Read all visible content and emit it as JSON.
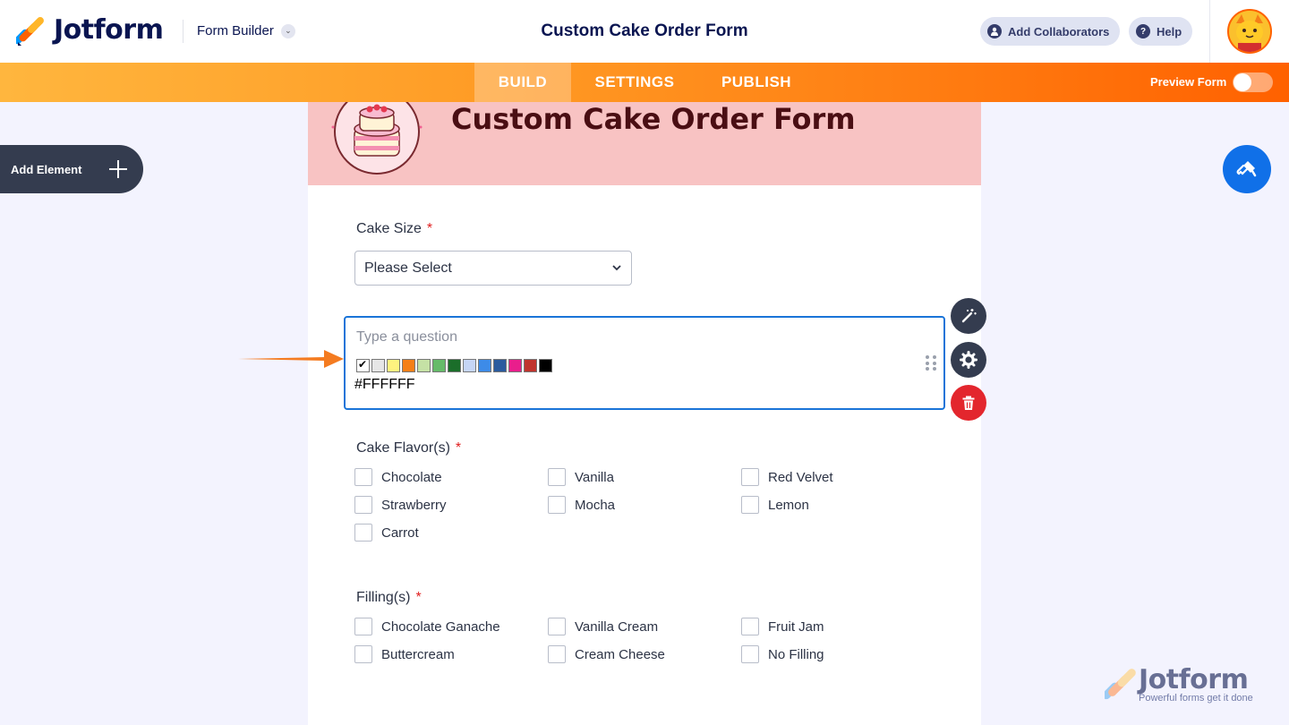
{
  "header": {
    "brand": "Jotform",
    "builder_label": "Form Builder",
    "form_title": "Custom Cake Order Form",
    "collaborators_label": "Add Collaborators",
    "help_label": "Help"
  },
  "nav": {
    "tabs": [
      {
        "label": "BUILD",
        "active": true
      },
      {
        "label": "SETTINGS",
        "active": false
      },
      {
        "label": "PUBLISH",
        "active": false
      }
    ],
    "preview_label": "Preview Form",
    "preview_on": false
  },
  "sidebar": {
    "add_element_label": "Add Element"
  },
  "form": {
    "title": "Custom Cake Order Form",
    "header_color": "#F8C3C3",
    "cake_size": {
      "label": "Cake Size",
      "required": "*",
      "select_value": "Please Select"
    },
    "active_question": {
      "placeholder": "Type a question",
      "swatch_colors": [
        "#FFFFFF",
        "#E6E6E6",
        "#FFF27F",
        "#F57F17",
        "#C5E1A5",
        "#66BB6A",
        "#1B6E2A",
        "#C5D5F5",
        "#3D8BE8",
        "#2A5B9E",
        "#E91E8C",
        "#C0342D",
        "#000000"
      ],
      "selected_color": "#FFFFFF",
      "hex_value": "#FFFFFF"
    },
    "flavors": {
      "label": "Cake Flavor(s)",
      "required": "*",
      "options": [
        "Chocolate",
        "Vanilla",
        "Red Velvet",
        "Strawberry",
        "Mocha",
        "Lemon",
        "Carrot"
      ]
    },
    "fillings": {
      "label": "Filling(s)",
      "required": "*",
      "options": [
        "Chocolate Ganache",
        "Vanilla Cream",
        "Fruit Jam",
        "Buttercream",
        "Cream Cheese",
        "No Filling"
      ]
    }
  },
  "watermark": {
    "brand": "Jotform",
    "tagline": "Powerful forms get it done"
  },
  "colors": {
    "accent_orange": "#FF6100",
    "navy": "#0A1551",
    "active_border": "#1A74D8",
    "delete_red": "#E3262D"
  }
}
